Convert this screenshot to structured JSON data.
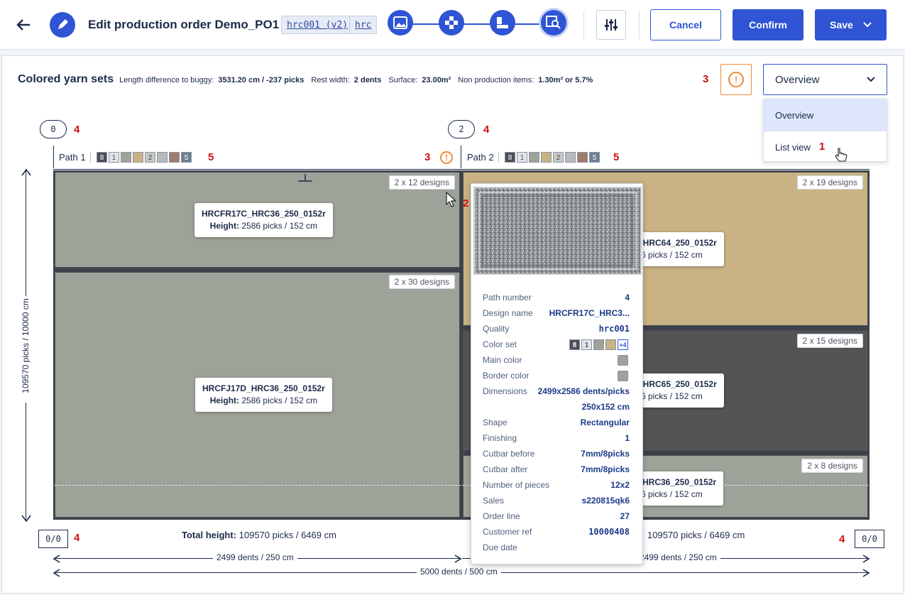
{
  "header": {
    "title_prefix": "Edit production order ",
    "title_name": "Demo_PO1",
    "quality_chip": "hrc001 (v2)",
    "quality_group_chip": "hrc",
    "cancel_label": "Cancel",
    "confirm_label": "Confirm",
    "save_label": "Save"
  },
  "summary": {
    "title": "Colored yarn sets",
    "length_diff_label": "Length difference to buggy:",
    "length_diff_value": "3531.20 cm / -237 picks",
    "rest_width_label": "Rest width:",
    "rest_width_value": "2 dents",
    "surface_label": "Surface:",
    "surface_value": "23.00m²",
    "non_prod_label": "Non production items:",
    "non_prod_value": "1.30m² or 5.7%"
  },
  "view_select": {
    "selected": "Overview",
    "options": [
      "Overview",
      "List view"
    ]
  },
  "annotations": {
    "n1": "1",
    "n2": "2",
    "n3": "3",
    "n4": "4",
    "n5": "5"
  },
  "path1": {
    "label": "Path 1",
    "count": "0",
    "colors": [
      {
        "t": "8",
        "c": "#4a4f57",
        "fg": "#ffffff"
      },
      {
        "t": "1",
        "c": "#e3e5e8",
        "fg": "#555555"
      },
      {
        "t": "",
        "c": "#9ea39a"
      },
      {
        "t": "",
        "c": "#c9b384"
      },
      {
        "t": "2",
        "c": "#c7c9c5",
        "fg": "#444444"
      },
      {
        "t": "",
        "c": "#b6bbbd"
      },
      {
        "t": "",
        "c": "#a07a6a"
      },
      {
        "t": "5",
        "c": "#6e7f8f",
        "fg": "#ffffff"
      }
    ],
    "cells": [
      {
        "badge": "2 x 12 designs",
        "name": "HRCFR17C_HRC36_250_0152r",
        "height_label": "Height:",
        "height_value": "2586 picks / 152 cm"
      },
      {
        "badge": "2 x 30 designs",
        "name": "HRCFJ17D_HRC36_250_0152r",
        "height_label": "Height:",
        "height_value": "2586 picks / 152 cm"
      }
    ],
    "rest": "0/0",
    "total_height_label": "Total height:",
    "total_height_value": "109570 picks / 6469 cm",
    "width": "2499 dents / 250 cm"
  },
  "path2": {
    "label": "Path 2",
    "count": "2",
    "cells": [
      {
        "badge": "2 x 19 designs",
        "name": "HRCSE_HRC64_250_0152r",
        "name_visible": "SE_HRC64_250_0152r",
        "height_value": "2586 picks / 152 cm"
      },
      {
        "badge": "2 x 15 designs",
        "name_visible": "SE_HRC65_250_0152r",
        "height_value": "2586 picks / 152 cm"
      },
      {
        "badge": "2 x 8 designs",
        "name_visible": "7C_HRC36_250_0152r",
        "height_value": "2586 picks / 152 cm"
      }
    ],
    "rest": "0/0",
    "total_height_value": "109570 picks / 6469 cm",
    "width": "2499 dents / 250 cm"
  },
  "total_width": "5000 dents / 500 cm",
  "vertical_dimension": "109570 picks / 10000 cm",
  "tooltip": {
    "rows": [
      {
        "k": "Path number",
        "v": "4"
      },
      {
        "k": "Design name",
        "v": "HRCFR17C_HRC3..."
      },
      {
        "k": "Quality",
        "v": "hrc001"
      },
      {
        "k": "Color set",
        "v": "",
        "more": "+4"
      },
      {
        "k": "Main color",
        "v": ""
      },
      {
        "k": "Border color",
        "v": ""
      },
      {
        "k": "Dimensions",
        "v": "2499x2586 dents/picks"
      },
      {
        "k": "",
        "v": "250x152 cm"
      },
      {
        "k": "Shape",
        "v": "Rectangular"
      },
      {
        "k": "Finishing",
        "v": "1"
      },
      {
        "k": "Cutbar before",
        "v": "7mm/8picks"
      },
      {
        "k": "Cutbar after",
        "v": "7mm/8picks"
      },
      {
        "k": "Number of pieces",
        "v": "12x2"
      },
      {
        "k": "Sales",
        "v": "s220815qk6"
      },
      {
        "k": "Order line",
        "v": "27"
      },
      {
        "k": "Customer ref",
        "v": "10000408"
      },
      {
        "k": "Due date",
        "v": ""
      }
    ]
  },
  "colors": {
    "accent": "#2f54d4",
    "warning": "#f08a30",
    "annotation": "#d01010"
  }
}
